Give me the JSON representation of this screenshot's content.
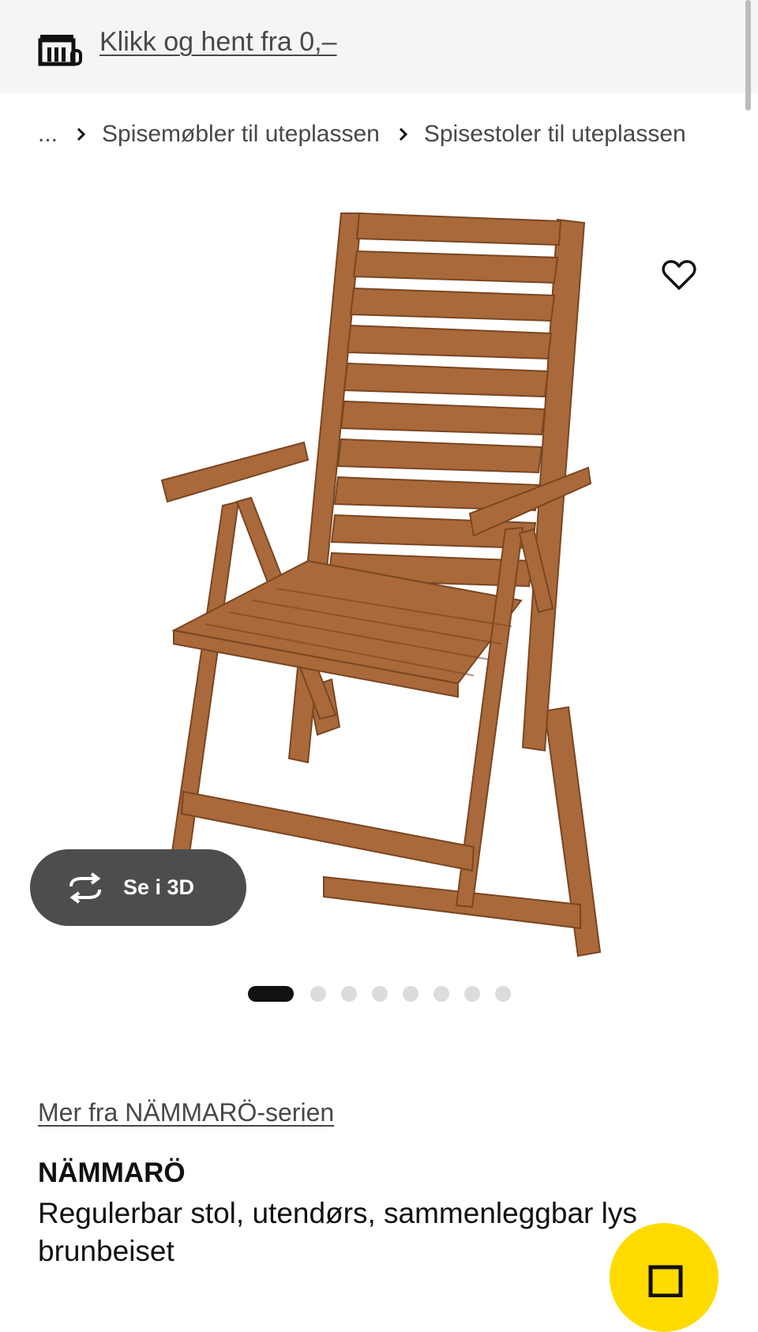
{
  "banner": {
    "icon": "store-pickup-icon",
    "link_text": "Klikk og hent fra 0,–"
  },
  "breadcrumb": {
    "ellipsis": "...",
    "items": [
      "Spisemøbler til uteplassen",
      "Spisestoler til uteplassen"
    ],
    "separator_icon": "chevron-right-icon"
  },
  "gallery": {
    "image_subject": "chair",
    "favorite_icon": "heart-icon",
    "view_3d": {
      "icon": "rotate-3d-icon",
      "label": "Se i 3D"
    },
    "slide_count": 8,
    "active_slide": 1
  },
  "product": {
    "series_link": "Mer fra NÄMMARÖ-serien",
    "name": "NÄMMARÖ",
    "description": "Regulerbar stol, utendørs, sammenleggbar lys brunbeiset"
  },
  "cart_button": {
    "icon": "shopping-bag-icon"
  },
  "colors": {
    "banner_bg": "#f5f5f5",
    "wood": "#a9693a",
    "pill_bg": "#4d4d4d",
    "accent_yellow": "#ffdb00"
  }
}
